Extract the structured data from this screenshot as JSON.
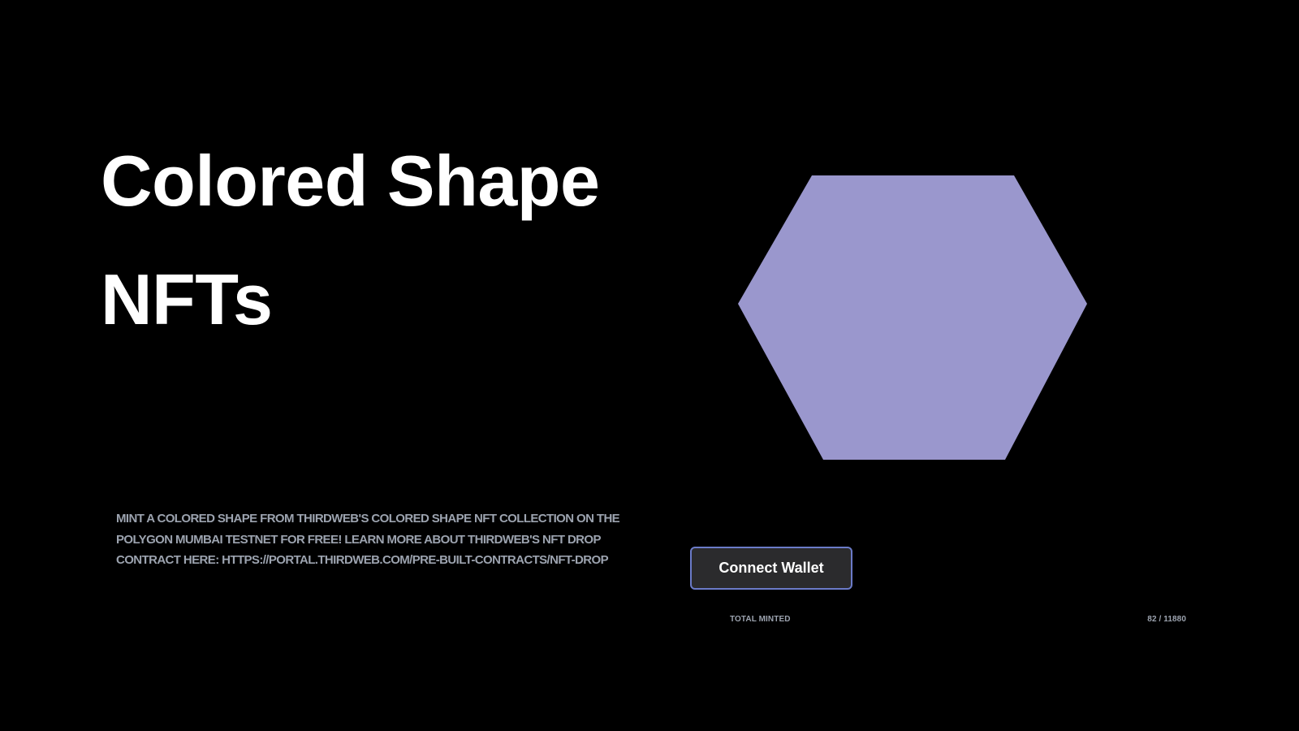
{
  "hero": {
    "title": "Colored Shape NFTs",
    "description": "MINT A COLORED SHAPE FROM THIRDWEB'S COLORED SHAPE NFT COLLECTION ON THE POLYGON MUMBAI TESTNET FOR FREE! LEARN MORE ABOUT THIRDWEB'S NFT DROP CONTRACT HERE: HTTPS://PORTAL.THIRDWEB.COM/PRE-BUILT-CONTRACTS/NFT-DROP"
  },
  "nft_preview": {
    "shape": "hexagon",
    "fill_color": "#9a97cd"
  },
  "wallet": {
    "connect_label": "Connect Wallet"
  },
  "stats": {
    "total_minted_label": "TOTAL MINTED",
    "total_minted_value": "82 / 11880"
  },
  "colors": {
    "background": "#000000",
    "text_primary": "#ffffff",
    "text_muted": "#9ca3af",
    "button_bg": "#2b2b2d",
    "button_border": "#6b7bc8"
  }
}
